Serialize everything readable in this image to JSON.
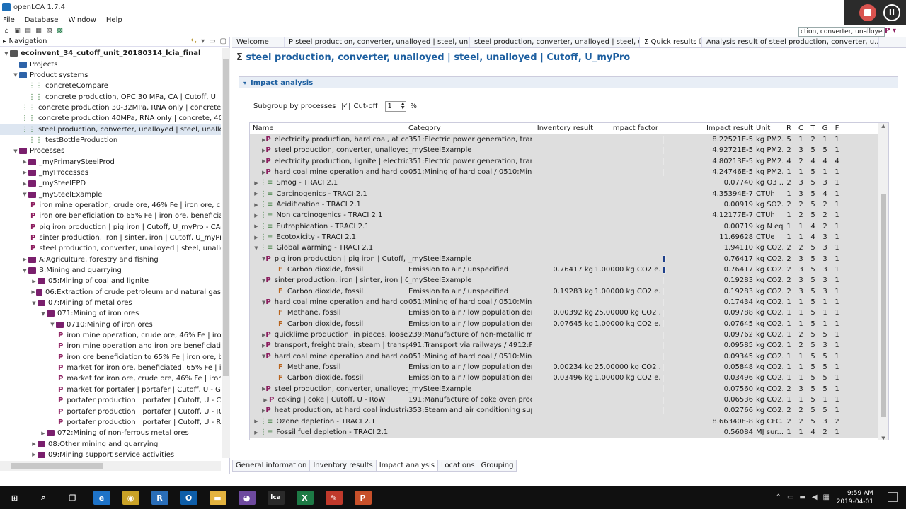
{
  "window": {
    "title": "openLCA 1.7.4"
  },
  "menu": [
    "File",
    "Database",
    "Window",
    "Help"
  ],
  "search_value": "ction, converter, unalloyed",
  "navigation": {
    "title": "Navigation",
    "tree": [
      {
        "label": "ecoinvent_34_cutoff_unit_20180314_lcia_final",
        "level": 0,
        "icon": "db",
        "twisty": "v",
        "bold": true
      },
      {
        "label": "Projects",
        "level": 1,
        "icon": "folder",
        "twisty": ""
      },
      {
        "label": "Product systems",
        "level": 1,
        "icon": "folder",
        "twisty": "v"
      },
      {
        "label": "concreteCompare",
        "level": 2,
        "icon": "system",
        "twisty": ""
      },
      {
        "label": "concrete production, OPC 30 MPa, CA | Cutoff, U",
        "level": 2,
        "icon": "system",
        "twisty": ""
      },
      {
        "label": "concrete production 30-32MPa, RNA only | concrete, 30-32",
        "level": 2,
        "icon": "system",
        "twisty": ""
      },
      {
        "label": "concrete production 40MPa, RNA only | concrete, 40MPa | C",
        "level": 2,
        "icon": "system",
        "twisty": ""
      },
      {
        "label": "steel production, converter, unalloyed | steel, unalloyed | C",
        "level": 2,
        "icon": "system",
        "twisty": "",
        "selected": true
      },
      {
        "label": "testBottleProduction",
        "level": 2,
        "icon": "system",
        "twisty": ""
      },
      {
        "label": "Processes",
        "level": 1,
        "icon": "folder-purple",
        "twisty": "v"
      },
      {
        "label": "_myPrimarySteelProd",
        "level": 2,
        "icon": "folder-purple",
        "twisty": ">"
      },
      {
        "label": "_myProcesses",
        "level": 2,
        "icon": "folder-purple",
        "twisty": ">"
      },
      {
        "label": "_mySteelEPD",
        "level": 2,
        "icon": "folder-purple",
        "twisty": ">"
      },
      {
        "label": "_mySteelExample",
        "level": 2,
        "icon": "folder-purple",
        "twisty": "v"
      },
      {
        "label": "iron mine operation, crude ore, 46% Fe | iron ore, crude",
        "level": 3,
        "icon": "process",
        "twisty": ""
      },
      {
        "label": "iron ore beneficiation to 65% Fe | iron ore, beneficiated",
        "level": 3,
        "icon": "process",
        "twisty": ""
      },
      {
        "label": "pig iron production | pig iron | Cutoff, U_myPro - CA-AB",
        "level": 3,
        "icon": "process",
        "twisty": ""
      },
      {
        "label": "sinter production, iron | sinter, iron | Cutoff, U_myPro - C",
        "level": 3,
        "icon": "process",
        "twisty": ""
      },
      {
        "label": "steel production, converter, unalloyed | steel, unalloyed",
        "level": 3,
        "icon": "process",
        "twisty": ""
      },
      {
        "label": "A:Agriculture, forestry and fishing",
        "level": 2,
        "icon": "folder-purple",
        "twisty": ">"
      },
      {
        "label": "B:Mining and quarrying",
        "level": 2,
        "icon": "folder-purple",
        "twisty": "v"
      },
      {
        "label": "05:Mining of coal and lignite",
        "level": 3,
        "icon": "folder-purple",
        "twisty": ">"
      },
      {
        "label": "06:Extraction of crude petroleum and natural gas",
        "level": 3,
        "icon": "folder-purple",
        "twisty": ">"
      },
      {
        "label": "07:Mining of metal ores",
        "level": 3,
        "icon": "folder-purple",
        "twisty": "v"
      },
      {
        "label": "071:Mining of iron ores",
        "level": 4,
        "icon": "folder-purple",
        "twisty": "v"
      },
      {
        "label": "0710:Mining of iron ores",
        "level": 5,
        "icon": "folder-purple",
        "twisty": "v"
      },
      {
        "label": "iron mine operation, crude ore, 46% Fe | iron c",
        "level": 6,
        "icon": "process",
        "twisty": ""
      },
      {
        "label": "iron mine operation and iron ore beneficiation",
        "level": 6,
        "icon": "process",
        "twisty": ""
      },
      {
        "label": "iron ore beneficiation to 65% Fe | iron ore, ber",
        "level": 6,
        "icon": "process",
        "twisty": ""
      },
      {
        "label": "market for iron ore, beneficiated, 65% Fe | iron",
        "level": 6,
        "icon": "process",
        "twisty": ""
      },
      {
        "label": "market for iron ore, crude ore, 46% Fe | iron or",
        "level": 6,
        "icon": "process",
        "twisty": ""
      },
      {
        "label": "market for portafer | portafer | Cutoff, U - GLO",
        "level": 6,
        "icon": "process",
        "twisty": ""
      },
      {
        "label": "portafer production | portafer | Cutoff, U - CA-",
        "level": 6,
        "icon": "process",
        "twisty": ""
      },
      {
        "label": "portafer production | portafer | Cutoff, U - RER",
        "level": 6,
        "icon": "process",
        "twisty": ""
      },
      {
        "label": "portafer production | portafer | Cutoff, U - RoV",
        "level": 6,
        "icon": "process",
        "twisty": ""
      },
      {
        "label": "072:Mining of non-ferrous metal ores",
        "level": 4,
        "icon": "folder-purple",
        "twisty": ">"
      },
      {
        "label": "08:Other mining and quarrying",
        "level": 3,
        "icon": "folder-purple",
        "twisty": ">"
      },
      {
        "label": "09:Mining support service activities",
        "level": 3,
        "icon": "folder-purple",
        "twisty": ">"
      }
    ]
  },
  "tabs": [
    {
      "label": "Welcome",
      "active": false
    },
    {
      "label": "P  steel production, converter, unalloyed | steel, un...",
      "active": false
    },
    {
      "label": "steel production, converter, unalloyed | steel, un...",
      "active": false
    },
    {
      "label": "Σ  Quick results  ☒",
      "active": true
    },
    {
      "label": "Analysis result of steel production, converter, u...",
      "active": false
    }
  ],
  "editor": {
    "title": "steel production, converter, unalloyed | steel, unalloyed | Cutoff, U_myPro",
    "section": "Impact analysis",
    "subgroup_label": "Subgroup by processes",
    "cutoff_label": "Cut-off",
    "cutoff_value": "1",
    "percent": "%"
  },
  "table": {
    "headers": {
      "name": "Name",
      "category": "Category",
      "inventory": "Inventory result",
      "factor": "Impact factor",
      "result": "Impact result",
      "unit": "Unit",
      "r": "R",
      "c": "C",
      "t": "T",
      "g": "G",
      "f": "F"
    },
    "rows": [
      {
        "level": 1,
        "type": "P",
        "tw": ">",
        "name": "electricity production, hard coal, at coal r",
        "category": "351:Electric power generation, transm...",
        "inventory": "",
        "factor": "",
        "bar": 0.0,
        "result": "8.22521E-5",
        "unit": "kg PM2...",
        "r": "5",
        "c": "1",
        "t": "2",
        "g": "1",
        "f": "1"
      },
      {
        "level": 1,
        "type": "P",
        "tw": ">",
        "name": "steel production, converter, unalloyed | st",
        "category": "_mySteelExample",
        "inventory": "",
        "factor": "",
        "bar": 0.0,
        "result": "4.92721E-5",
        "unit": "kg PM2...",
        "r": "2",
        "c": "3",
        "t": "5",
        "g": "5",
        "f": "1"
      },
      {
        "level": 1,
        "type": "P",
        "tw": ">",
        "name": "electricity production, lignite | electricity,",
        "category": "351:Electric power generation, transm...",
        "inventory": "",
        "factor": "",
        "bar": 0.0,
        "result": "4.80213E-5",
        "unit": "kg PM2...",
        "r": "4",
        "g": "4",
        "c": "2",
        "t": "4",
        "f": "4"
      },
      {
        "level": 1,
        "type": "P",
        "tw": ">",
        "name": "hard coal mine operation and hard coal p",
        "category": "051:Mining of hard coal / 0510:Minin...",
        "inventory": "",
        "factor": "",
        "bar": 0.0,
        "result": "4.24746E-5",
        "unit": "kg PM2...",
        "r": "1",
        "c": "1",
        "t": "5",
        "g": "1",
        "f": "1"
      },
      {
        "level": 0,
        "type": "I",
        "tw": ">",
        "name": "Smog - TRACI 2.1",
        "category": "",
        "inventory": "",
        "factor": "",
        "bar": null,
        "result": "0.07740",
        "unit": "kg O3 ...",
        "r": "2",
        "c": "3",
        "t": "5",
        "g": "3",
        "f": "1"
      },
      {
        "level": 0,
        "type": "I",
        "tw": ">",
        "name": "Carcinogenics - TRACI 2.1",
        "category": "",
        "inventory": "",
        "factor": "",
        "bar": null,
        "result": "4.35394E-7",
        "unit": "CTUh",
        "r": "1",
        "c": "3",
        "t": "5",
        "g": "4",
        "f": "1"
      },
      {
        "level": 0,
        "type": "I",
        "tw": ">",
        "name": "Acidification - TRACI 2.1",
        "category": "",
        "inventory": "",
        "factor": "",
        "bar": null,
        "result": "0.00919",
        "unit": "kg SO2...",
        "r": "2",
        "c": "2",
        "t": "5",
        "g": "2",
        "f": "1"
      },
      {
        "level": 0,
        "type": "I",
        "tw": ">",
        "name": "Non carcinogenics - TRACI 2.1",
        "category": "",
        "inventory": "",
        "factor": "",
        "bar": null,
        "result": "4.12177E-7",
        "unit": "CTUh",
        "r": "1",
        "c": "2",
        "t": "5",
        "g": "2",
        "f": "1"
      },
      {
        "level": 0,
        "type": "I",
        "tw": ">",
        "name": "Eutrophication - TRACI 2.1",
        "category": "",
        "inventory": "",
        "factor": "",
        "bar": null,
        "result": "0.00719",
        "unit": "kg N eq",
        "r": "1",
        "c": "1",
        "t": "4",
        "g": "2",
        "f": "1"
      },
      {
        "level": 0,
        "type": "I",
        "tw": ">",
        "name": "Ecotoxicity - TRACI 2.1",
        "category": "",
        "inventory": "",
        "factor": "",
        "bar": null,
        "result": "11.69628",
        "unit": "CTUe",
        "r": "1",
        "c": "1",
        "t": "4",
        "g": "3",
        "f": "1"
      },
      {
        "level": 0,
        "type": "I",
        "tw": "v",
        "name": "Global warming - TRACI 2.1",
        "category": "",
        "inventory": "",
        "factor": "",
        "bar": null,
        "result": "1.94110",
        "unit": "kg CO2...",
        "r": "2",
        "c": "2",
        "t": "5",
        "g": "3",
        "f": "1"
      },
      {
        "level": 1,
        "type": "P",
        "tw": "v",
        "name": "pig iron production | pig iron | Cutoff, U_",
        "category": "_mySteelExample",
        "inventory": "",
        "factor": "",
        "bar": 0.39,
        "result": "0.76417",
        "unit": "kg CO2...",
        "r": "2",
        "c": "3",
        "t": "5",
        "g": "3",
        "f": "1"
      },
      {
        "level": 2,
        "type": "F",
        "tw": "",
        "name": "Carbon dioxide, fossil",
        "category": "Emission to air / unspecified",
        "inventory": "0.76417 kg",
        "factor": "1.00000 kg CO2 e...",
        "bar": 0.39,
        "result": "0.76417",
        "unit": "kg CO2...",
        "r": "2",
        "c": "3",
        "t": "5",
        "g": "3",
        "f": "1"
      },
      {
        "level": 1,
        "type": "P",
        "tw": "v",
        "name": "sinter production, iron | sinter, iron | Cuto",
        "category": "_mySteelExample",
        "inventory": "",
        "factor": "",
        "bar": 0.1,
        "result": "0.19283",
        "unit": "kg CO2...",
        "r": "2",
        "c": "3",
        "t": "5",
        "g": "3",
        "f": "1"
      },
      {
        "level": 2,
        "type": "F",
        "tw": "",
        "name": "Carbon dioxide, fossil",
        "category": "Emission to air / unspecified",
        "inventory": "0.19283 kg",
        "factor": "1.00000 kg CO2 e...",
        "bar": 0.1,
        "result": "0.19283",
        "unit": "kg CO2...",
        "r": "2",
        "c": "3",
        "t": "5",
        "g": "3",
        "f": "1"
      },
      {
        "level": 1,
        "type": "P",
        "tw": "v",
        "name": "hard coal mine operation and hard coal p",
        "category": "051:Mining of hard coal / 0510:Minin...",
        "inventory": "",
        "factor": "",
        "bar": 0.09,
        "result": "0.17434",
        "unit": "kg CO2...",
        "r": "1",
        "c": "1",
        "t": "5",
        "g": "1",
        "f": "1"
      },
      {
        "level": 2,
        "type": "F",
        "tw": "",
        "name": "Methane, fossil",
        "category": "Emission to air / low population dens...",
        "inventory": "0.00392 kg",
        "factor": "25.00000 kg CO2 ...",
        "bar": 0.05,
        "result": "0.09788",
        "unit": "kg CO2...",
        "r": "1",
        "c": "1",
        "t": "5",
        "g": "1",
        "f": "1"
      },
      {
        "level": 2,
        "type": "F",
        "tw": "",
        "name": "Carbon dioxide, fossil",
        "category": "Emission to air / low population dens...",
        "inventory": "0.07645 kg",
        "factor": "1.00000 kg CO2 e...",
        "bar": 0.04,
        "result": "0.07645",
        "unit": "kg CO2...",
        "r": "1",
        "c": "1",
        "t": "5",
        "g": "1",
        "f": "1"
      },
      {
        "level": 1,
        "type": "P",
        "tw": ">",
        "name": "quicklime production, in pieces, loose | q",
        "category": "239:Manufacture of non-metallic min...",
        "inventory": "",
        "factor": "",
        "bar": 0.05,
        "result": "0.09762",
        "unit": "kg CO2...",
        "r": "1",
        "c": "2",
        "t": "5",
        "g": "5",
        "f": "1"
      },
      {
        "level": 1,
        "type": "P",
        "tw": ">",
        "name": "transport, freight train, steam | transport,",
        "category": "491:Transport via railways / 4912:Frei...",
        "inventory": "",
        "factor": "",
        "bar": 0.05,
        "result": "0.09585",
        "unit": "kg CO2...",
        "r": "1",
        "c": "2",
        "t": "5",
        "g": "3",
        "f": "1"
      },
      {
        "level": 1,
        "type": "P",
        "tw": "v",
        "name": "hard coal mine operation and hard coal p",
        "category": "051:Mining of hard coal / 0510:Minin...",
        "inventory": "",
        "factor": "",
        "bar": 0.05,
        "result": "0.09345",
        "unit": "kg CO2...",
        "r": "1",
        "c": "1",
        "t": "5",
        "g": "5",
        "f": "1"
      },
      {
        "level": 2,
        "type": "F",
        "tw": "",
        "name": "Methane, fossil",
        "category": "Emission to air / low population dens...",
        "inventory": "0.00234 kg",
        "factor": "25.00000 kg CO2 ...",
        "bar": 0.03,
        "result": "0.05848",
        "unit": "kg CO2...",
        "r": "1",
        "c": "1",
        "t": "5",
        "g": "5",
        "f": "1"
      },
      {
        "level": 2,
        "type": "F",
        "tw": "",
        "name": "Carbon dioxide, fossil",
        "category": "Emission to air / low population dens...",
        "inventory": "0.03496 kg",
        "factor": "1.00000 kg CO2 e...",
        "bar": 0.02,
        "result": "0.03496",
        "unit": "kg CO2...",
        "r": "1",
        "c": "1",
        "t": "5",
        "g": "5",
        "f": "1"
      },
      {
        "level": 1,
        "type": "P",
        "tw": ">",
        "name": "steel production, converter, unalloyed | st",
        "category": "_mySteelExample",
        "inventory": "",
        "factor": "",
        "bar": 0.04,
        "result": "0.07560",
        "unit": "kg CO2...",
        "r": "2",
        "c": "3",
        "t": "5",
        "g": "5",
        "f": "1"
      },
      {
        "level": 1,
        "type": "P",
        "tw": ">",
        "name": "coking | coke | Cutoff, U - RoW",
        "category": "191:Manufacture of coke oven produ...",
        "inventory": "",
        "factor": "",
        "bar": 0.03,
        "result": "0.06536",
        "unit": "kg CO2...",
        "r": "1",
        "c": "1",
        "t": "5",
        "g": "1",
        "f": "1"
      },
      {
        "level": 1,
        "type": "P",
        "tw": ">",
        "name": "heat production, at hard coal industrial fu",
        "category": "353:Steam and air conditioning suppl...",
        "inventory": "",
        "factor": "",
        "bar": 0.01,
        "result": "0.02766",
        "unit": "kg CO2...",
        "r": "2",
        "c": "2",
        "t": "5",
        "g": "5",
        "f": "1"
      },
      {
        "level": 0,
        "type": "I",
        "tw": ">",
        "name": "Ozone depletion - TRACI 2.1",
        "category": "",
        "inventory": "",
        "factor": "",
        "bar": null,
        "result": "8.66340E-8",
        "unit": "kg CFC...",
        "r": "2",
        "c": "2",
        "t": "5",
        "g": "3",
        "f": "2"
      },
      {
        "level": 0,
        "type": "I",
        "tw": ">",
        "name": "Fossil fuel depletion - TRACI 2.1",
        "category": "",
        "inventory": "",
        "factor": "",
        "bar": null,
        "result": "0.56084",
        "unit": "MJ sur...",
        "r": "1",
        "c": "1",
        "t": "4",
        "g": "2",
        "f": "1"
      }
    ]
  },
  "bottom_tabs": [
    {
      "label": "General information",
      "active": false
    },
    {
      "label": "Inventory results",
      "active": false
    },
    {
      "label": "Impact analysis",
      "active": true
    },
    {
      "label": "Locations",
      "active": false
    },
    {
      "label": "Grouping",
      "active": false
    }
  ],
  "taskbar": {
    "apps": [
      {
        "name": "start",
        "glyph": "⊞",
        "color": "#101010"
      },
      {
        "name": "search",
        "glyph": "⌕",
        "color": "#101010"
      },
      {
        "name": "task-view",
        "glyph": "❐",
        "color": "#101010"
      },
      {
        "name": "edge",
        "glyph": "e",
        "color": "#1e73c8"
      },
      {
        "name": "chrome",
        "glyph": "◉",
        "color": "#c9a227"
      },
      {
        "name": "r",
        "glyph": "R",
        "color": "#2a6eb8"
      },
      {
        "name": "outlook",
        "glyph": "O",
        "color": "#0f5ea8"
      },
      {
        "name": "explorer",
        "glyph": "▬",
        "color": "#e3b33f"
      },
      {
        "name": "github",
        "glyph": "◕",
        "color": "#6e4a9e"
      },
      {
        "name": "openlca",
        "glyph": "lca",
        "color": "#2a2a2a"
      },
      {
        "name": "excel",
        "glyph": "X",
        "color": "#1d7a45"
      },
      {
        "name": "pdf",
        "glyph": "✎",
        "color": "#c0392b"
      },
      {
        "name": "powerpoint",
        "glyph": "P",
        "color": "#c8502a"
      }
    ],
    "time": "9:59 AM",
    "date": "2019-04-01"
  }
}
